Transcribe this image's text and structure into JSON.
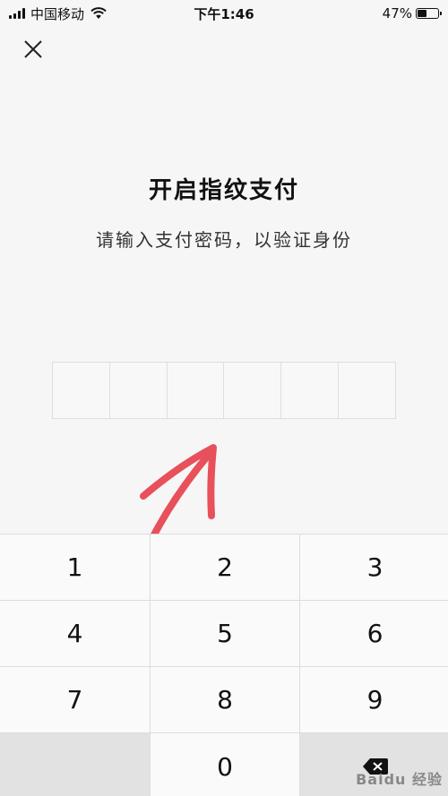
{
  "status_bar": {
    "carrier": "中国移动",
    "time": "下午1:46",
    "battery_percent": "47%",
    "battery_level": 0.47,
    "signal_icon": "signal-bars-icon",
    "wifi_icon": "wifi-icon"
  },
  "header": {
    "close_icon": "close-icon"
  },
  "main": {
    "title": "开启指纹支付",
    "subtitle": "请输入支付密码，以验证身份",
    "pin_length": 6
  },
  "keypad": {
    "keys": [
      "1",
      "2",
      "3",
      "4",
      "5",
      "6",
      "7",
      "8",
      "9",
      "",
      "0",
      "backspace"
    ],
    "backspace_icon": "backspace-icon"
  },
  "annotation": {
    "color": "#e8505b"
  },
  "watermark": {
    "text": "Baidu 经验"
  }
}
